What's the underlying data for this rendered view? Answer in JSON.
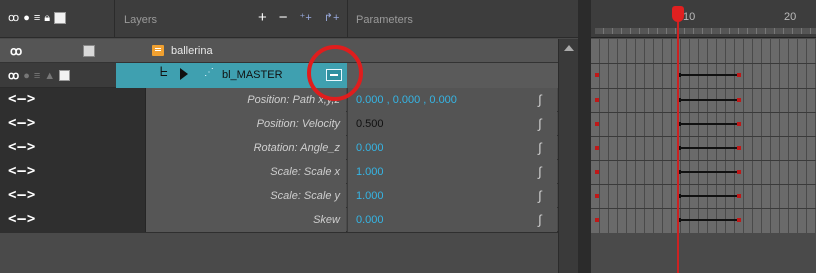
{
  "header": {
    "layers_label": "Layers",
    "parameters_label": "Parameters",
    "tools": [
      "+",
      "−",
      "⁺+",
      "↱+"
    ]
  },
  "layers": {
    "ballerina": {
      "name": "ballerina"
    },
    "master": {
      "name": "bl_MASTER"
    }
  },
  "parameter_rows": [
    {
      "arrows": "<—>",
      "name": "Position: Path x,y,z",
      "value": "0.000 , 0.000 , 0.000",
      "value_style": "blue"
    },
    {
      "arrows": "<—>",
      "name": "Position: Velocity",
      "value": "0.500",
      "value_style": "dark"
    },
    {
      "arrows": "<—>",
      "name": "Rotation: Angle_z",
      "value": "0.000",
      "value_style": "blue"
    },
    {
      "arrows": "<—>",
      "name": "Scale: Scale x",
      "value": "1.000",
      "value_style": "blue"
    },
    {
      "arrows": "<—>",
      "name": "Scale: Scale y",
      "value": "1.000",
      "value_style": "blue"
    },
    {
      "arrows": "<—>",
      "name": "Skew",
      "value": "0.000",
      "value_style": "blue"
    }
  ],
  "timeline": {
    "frame_labels": [
      "10",
      "20"
    ],
    "current_frame": 10
  },
  "colors": {
    "selection": "#3fa0b0",
    "value_blue": "#35b5e5",
    "highlight_circle": "#e01d1d",
    "playhead": "#e02020"
  }
}
